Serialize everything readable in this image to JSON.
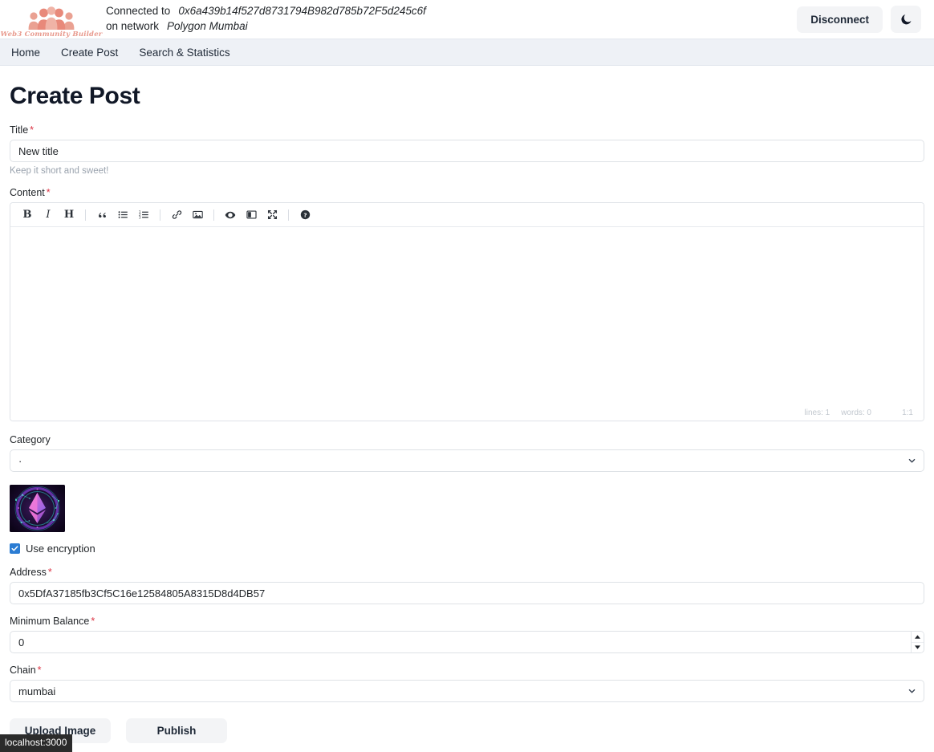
{
  "header": {
    "brand_name": "Web3 Community Builder",
    "connected_label": "Connected to",
    "wallet_address": "0x6a439b14f527d8731794B982d785b72F5d245c6f",
    "network_label": "on network",
    "network_name": "Polygon Mumbai",
    "disconnect_label": "Disconnect",
    "theme_toggle_icon": "moon-icon"
  },
  "nav": {
    "items": [
      {
        "label": "Home"
      },
      {
        "label": "Create Post"
      },
      {
        "label": "Search & Statistics"
      }
    ]
  },
  "page": {
    "title": "Create Post"
  },
  "form": {
    "title_field": {
      "label": "Title",
      "required_mark": "*",
      "value": "New title",
      "help": "Keep it short and sweet!"
    },
    "content_field": {
      "label": "Content",
      "required_mark": "*",
      "value": "",
      "toolbar": [
        {
          "name": "bold-icon",
          "glyph": "B",
          "title": "Bold"
        },
        {
          "name": "italic-icon",
          "glyph": "I",
          "title": "Italic"
        },
        {
          "name": "heading-icon",
          "glyph": "H",
          "title": "Heading"
        },
        {
          "name": "quote-icon",
          "glyph": "“",
          "title": "Quote"
        },
        {
          "name": "unordered-list-icon",
          "glyph": "",
          "title": "Generic List"
        },
        {
          "name": "ordered-list-icon",
          "glyph": "",
          "title": "Numbered List"
        },
        {
          "name": "link-icon",
          "glyph": "",
          "title": "Create Link"
        },
        {
          "name": "image-icon",
          "glyph": "",
          "title": "Insert Image"
        },
        {
          "name": "preview-icon",
          "glyph": "",
          "title": "Toggle Preview"
        },
        {
          "name": "side-by-side-icon",
          "glyph": "",
          "title": "Toggle Side by Side"
        },
        {
          "name": "fullscreen-icon",
          "glyph": "",
          "title": "Toggle Fullscreen"
        },
        {
          "name": "help-icon",
          "glyph": "?",
          "title": "Markdown Guide"
        }
      ],
      "status": {
        "lines": "lines: 1",
        "words": "words: 0",
        "cursor": "1:1"
      }
    },
    "category_field": {
      "label": "Category",
      "value": "·"
    },
    "thumbnail": {
      "name": "post-thumbnail-image",
      "alt": "ethereum-logo-thumbnail"
    },
    "encryption": {
      "label": "Use encryption",
      "checked": true
    },
    "address_field": {
      "label": "Address",
      "required_mark": "*",
      "value": "0x5DfA37185fb3Cf5C16e12584805A8315D8d4DB57"
    },
    "min_balance_field": {
      "label": "Minimum Balance",
      "required_mark": "*",
      "value": "0"
    },
    "chain_field": {
      "label": "Chain",
      "required_mark": "*",
      "value": "mumbai"
    },
    "buttons": {
      "upload_label": "Upload Image",
      "publish_label": "Publish"
    }
  },
  "status_bar": {
    "url": "localhost:3000"
  },
  "colors": {
    "brand": "#e8998d",
    "required": "#dc3545",
    "checkbox": "#2b7cd3",
    "navbar_bg": "#eef1f6",
    "button_bg": "#f3f4f6"
  }
}
